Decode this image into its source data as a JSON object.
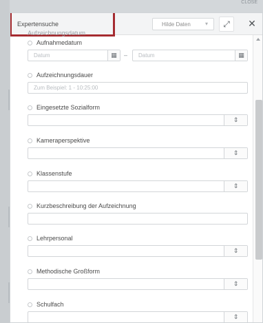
{
  "top_right_label": "CLOSE",
  "header": {
    "title": "Expertensuche",
    "hide_button": "Hilde Daten",
    "hide_caret": "▾",
    "expand_icon": "⤢",
    "close_icon": "✕"
  },
  "cut_label": "Aufzeichnungsdatum",
  "fields": [
    {
      "label": "Aufnahmedatum",
      "from_placeholder": "Datum",
      "to_placeholder": "Datum",
      "separator": "–"
    },
    {
      "label": "Aufzeichnungsdauer",
      "placeholder": "Zum Beispiel: 1 - 10:25:00"
    },
    {
      "label": "Eingesetzte Sozialform",
      "spin": "⇕"
    },
    {
      "label": "Kameraperspektive",
      "spin": "⇕"
    },
    {
      "label": "Klassenstufe",
      "spin": "⇕"
    },
    {
      "label": "Kurzbeschreibung der Aufzeichnung"
    },
    {
      "label": "Lehrpersonal",
      "spin": "⇕"
    },
    {
      "label": "Methodische Großform",
      "spin": "⇕"
    },
    {
      "label": "Schulfach",
      "spin": "⇕"
    }
  ],
  "icons": {
    "calendar": "calendar-icon",
    "spinner": "updown-icon"
  },
  "colors": {
    "highlight": "#a52b30",
    "background": "#d3d7da",
    "panel": "#ffffff"
  }
}
